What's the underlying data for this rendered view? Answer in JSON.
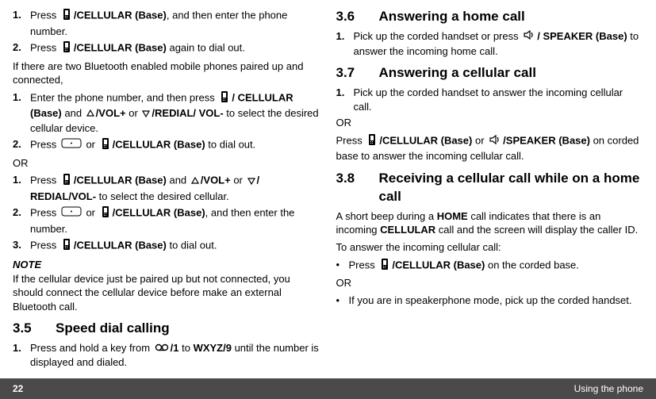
{
  "footer": {
    "page": "22",
    "section": "Using the phone"
  },
  "left": {
    "s1_1a": "Press ",
    "s1_1b": "/CELLULAR (Base)",
    "s1_1c": ", and then enter the phone number.",
    "s1_2a": "Press ",
    "s1_2b": "/CELLULAR (Base)",
    "s1_2c": " again to dial out.",
    "p1": "If there are two Bluetooth enabled mobile phones paired up and connected,",
    "s2_1a": "Enter the phone number, and then press ",
    "s2_1b": "/ CELLULAR (Base)",
    "s2_1c": " and ",
    "s2_1d": "/VOL+",
    "s2_1e": " or ",
    "s2_1f": "/REDIAL/ VOL-",
    "s2_1g": " to select the desired cellular device.",
    "s2_2a": "Press ",
    "s2_2b": " or ",
    "s2_2c": "/CELLULAR (Base)",
    "s2_2d": " to dial out.",
    "or1": "OR",
    "s3_1a": "Press ",
    "s3_1b": "/CELLULAR (Base)",
    "s3_1c": " and ",
    "s3_1d": "/VOL+",
    "s3_1e": " or ",
    "s3_1f": "/ REDIAL/VOL-",
    "s3_1g": " to select the desired cellular.",
    "s3_2a": "Press ",
    "s3_2b": " or ",
    "s3_2c": "/CELLULAR (Base)",
    "s3_2d": ", and then enter the number.",
    "s3_3a": "Press ",
    "s3_3b": "/CELLULAR (Base)",
    "s3_3c": " to dial out.",
    "note": "NOTE",
    "notetext": "If the cellular device just be paired up but not connected, you should connect the cellular device before make an external Bluetooth call.",
    "h35n": "3.5",
    "h35t": "Speed dial calling",
    "s5_1a": "Press and hold a key from ",
    "s5_1b": "/1",
    "s5_1c": " to ",
    "s5_1d": "WXYZ/9",
    "s5_1e": " until the number is displayed and dialed."
  },
  "right": {
    "h36n": "3.6",
    "h36t": "Answering a home call",
    "s6_1a": "Pick up the corded handset or press ",
    "s6_1b": "/ SPEAKER (Base)",
    "s6_1c": " to answer the incoming home call.",
    "h37n": "3.7",
    "h37t": "Answering a cellular call",
    "s7_1": "Pick up the corded handset to answer the incoming cellular call.",
    "or2": "OR",
    "p7a": "Press ",
    "p7b": "/CELLULAR (Base)",
    "p7c": " or ",
    "p7d": "/SPEAKER (Base)",
    "p7e": " on corded base to answer the incoming cellular call.",
    "h38n": "3.8",
    "h38t": "Receiving a cellular call while on a home call",
    "p8a": "A short beep during a ",
    "p8b": "HOME",
    "p8c": " call indicates that there is an incoming ",
    "p8d": "CELLULAR",
    "p8e": " call and the screen will display the caller ID.",
    "p8f": "To answer the incoming cellular call:",
    "b1a": "Press ",
    "b1b": "/CELLULAR (Base)",
    "b1c": " on the corded base.",
    "or3": "OR",
    "b2": "If you are in speakerphone mode, pick up the corded handset."
  }
}
